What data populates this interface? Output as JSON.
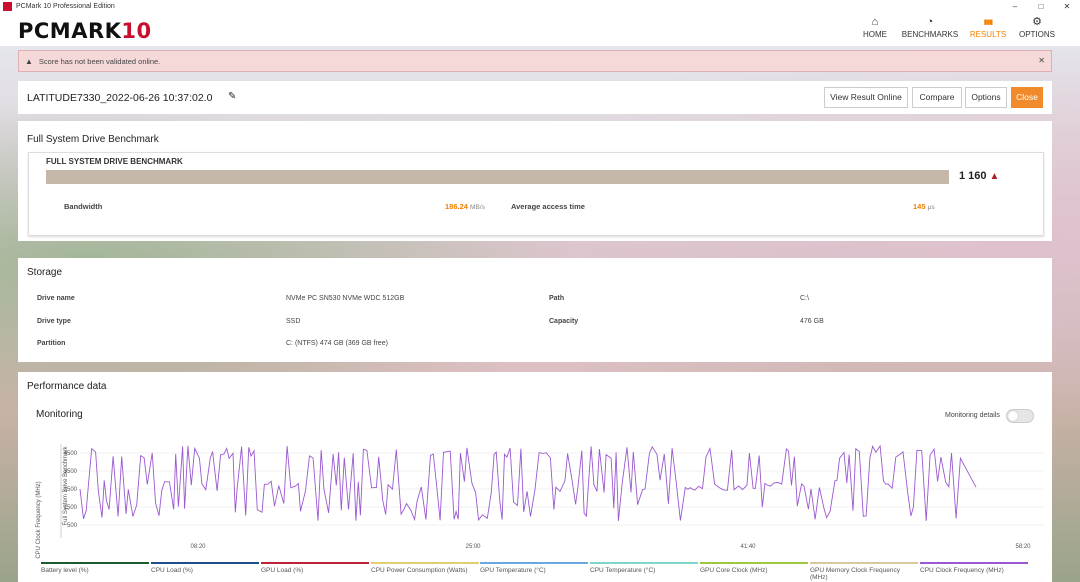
{
  "window": {
    "title": "PCMark 10 Professional Edition",
    "minimize": "–",
    "maximize": "□",
    "close": "✕"
  },
  "header": {
    "logo_text": "PCMARK",
    "logo_number": "10",
    "nav": [
      {
        "label": "HOME",
        "icon": "home-icon",
        "glyph": "⌂"
      },
      {
        "label": "BENCHMARKS",
        "icon": "gauge-icon",
        "glyph": "◔"
      },
      {
        "label": "RESULTS",
        "icon": "bar-chart-icon",
        "glyph": "▮▮▮"
      },
      {
        "label": "OPTIONS",
        "icon": "gear-icon",
        "glyph": "⚙"
      }
    ],
    "active_nav": "RESULTS"
  },
  "warning": {
    "text": "Score has not been validated online.",
    "icon": "warning-icon",
    "close": "✕"
  },
  "result": {
    "name": "LATITUDE7330_2022-06-26 10:37:02.0",
    "buttons": {
      "view_online": "View Result Online",
      "compare": "Compare",
      "options": "Options",
      "close": "Close"
    }
  },
  "benchmark": {
    "section_title": "Full System Drive Benchmark",
    "inner_label": "FULL SYSTEM DRIVE BENCHMARK",
    "score": "1 160",
    "score_warning": "▲",
    "bandwidth_label": "Bandwidth",
    "bandwidth_value": "186.24",
    "bandwidth_unit": "MB/s",
    "access_label": "Average access time",
    "access_value": "145",
    "access_unit": "μs"
  },
  "storage": {
    "section_title": "Storage",
    "drive_name_label": "Drive name",
    "drive_name": "NVMe PC SN530 NVMe WDC 512GB",
    "drive_type_label": "Drive type",
    "drive_type": "SSD",
    "partition_label": "Partition",
    "partition": "C: (NTFS) 474 GB (369 GB free)",
    "path_label": "Path",
    "path": "C:\\",
    "capacity_label": "Capacity",
    "capacity": "476 GB"
  },
  "performance": {
    "section_title": "Performance data",
    "monitoring_title": "Monitoring",
    "monitoring_details": "Monitoring details",
    "monitoring_details_on": false
  },
  "chart_data": {
    "type": "line",
    "ylabel": "CPU Clock Frequency (MHz)",
    "annotation": "Full System Drive Benchmark",
    "yticks": [
      4500,
      3500,
      2500,
      1500,
      500
    ],
    "ylim": [
      0,
      5000
    ],
    "xticks": [
      "08:20",
      "25:00",
      "41:40",
      "58:20"
    ],
    "series_color": "#9b59d0",
    "legend": [
      {
        "name": "Battery level (%)",
        "color": "#1a5c2e"
      },
      {
        "name": "CPU Load (%)",
        "color": "#1f4e8c"
      },
      {
        "name": "GPU Load (%)",
        "color": "#c0213a"
      },
      {
        "name": "CPU Power Consumption (Watts)",
        "color": "#e0d070"
      },
      {
        "name": "GPU Temperature (°C)",
        "color": "#6aa8e0"
      },
      {
        "name": "CPU Temperature (°C)",
        "color": "#7ed6c8"
      },
      {
        "name": "GPU Core Clock (MHz)",
        "color": "#9fc840"
      },
      {
        "name": "GPU Memory Clock Frequency (MHz)",
        "color": "#d8c8a0"
      },
      {
        "name": "CPU Clock Frequency (MHz)",
        "color": "#9b59d0"
      }
    ]
  }
}
